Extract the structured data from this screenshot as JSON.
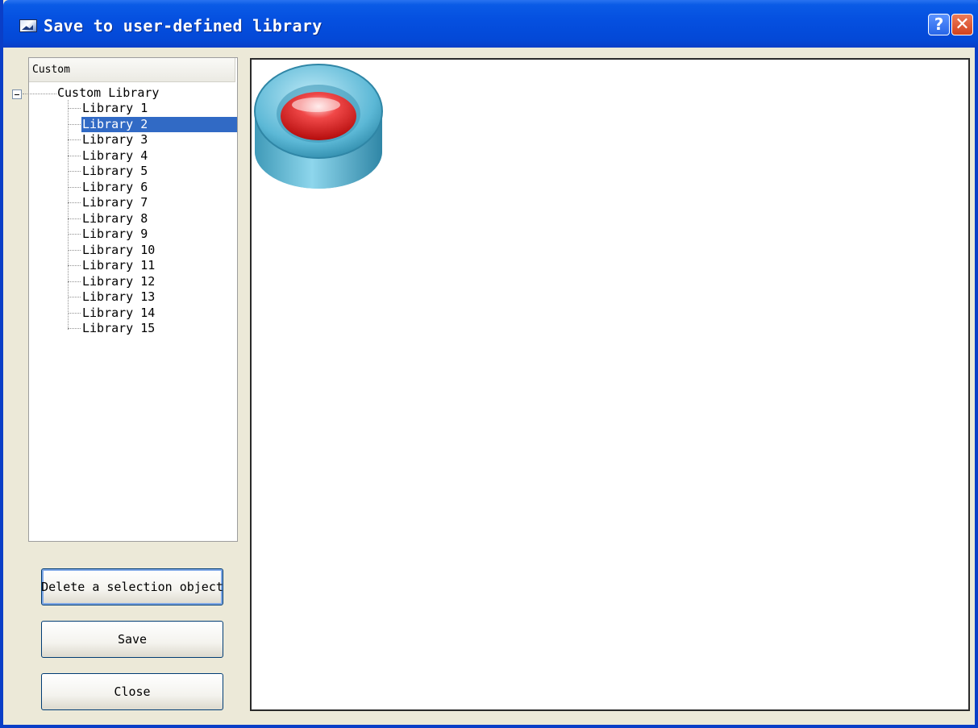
{
  "window": {
    "title": "Save to user-defined library",
    "help_button": "?",
    "close_button": "✕"
  },
  "tree": {
    "header": "Custom",
    "root_label": "Custom Library",
    "items": [
      {
        "label": "Library 1",
        "selected": false
      },
      {
        "label": "Library 2",
        "selected": true
      },
      {
        "label": "Library 3",
        "selected": false
      },
      {
        "label": "Library 4",
        "selected": false
      },
      {
        "label": "Library 5",
        "selected": false
      },
      {
        "label": "Library 6",
        "selected": false
      },
      {
        "label": "Library 7",
        "selected": false
      },
      {
        "label": "Library 8",
        "selected": false
      },
      {
        "label": "Library 9",
        "selected": false
      },
      {
        "label": "Library 10",
        "selected": false
      },
      {
        "label": "Library 11",
        "selected": false
      },
      {
        "label": "Library 12",
        "selected": false
      },
      {
        "label": "Library 13",
        "selected": false
      },
      {
        "label": "Library 14",
        "selected": false
      },
      {
        "label": "Library 15",
        "selected": false
      }
    ]
  },
  "buttons": {
    "delete_label": "Delete a selection object",
    "save_label": "Save",
    "close_label": "Close"
  },
  "preview": {
    "object_icon": "red-push-button-icon"
  },
  "colors": {
    "titlebar": "#0550e0",
    "selection": "#316ac5",
    "dialog_bg": "#ece9d8"
  }
}
